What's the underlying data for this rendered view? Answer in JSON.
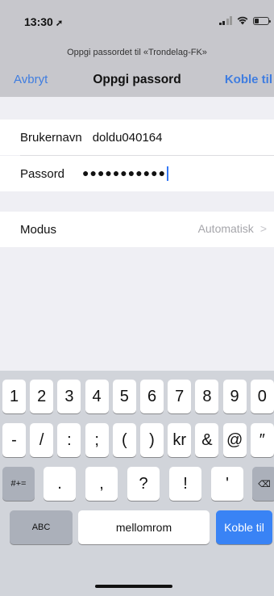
{
  "status": {
    "time": "13:30",
    "location_glyph": "➚"
  },
  "prompt": "Oppgi passordet til «Trondelag-FK»",
  "nav": {
    "cancel": "Avbryt",
    "title": "Oppgi passord",
    "connect": "Koble til"
  },
  "form": {
    "username_label": "Brukernavn",
    "username_value": "doldu040164",
    "password_label": "Passord",
    "password_value": "●●●●●●●●●●●",
    "mode_label": "Modus",
    "mode_value": "Automatisk",
    "mode_chevron": ">"
  },
  "keyboard": {
    "row1": [
      "1",
      "2",
      "3",
      "4",
      "5",
      "6",
      "7",
      "8",
      "9",
      "0"
    ],
    "row2": [
      "-",
      "/",
      ":",
      ";",
      "(",
      ")",
      "kr",
      "&",
      "@",
      "″"
    ],
    "row3": [
      "#+=",
      ".",
      ",",
      "?",
      "!",
      "'",
      "⌫"
    ],
    "row4": [
      "ABC",
      "mellomrom",
      "Koble til"
    ]
  },
  "colors": {
    "accent": "#3f7de0",
    "return_key": "#3983f5"
  }
}
